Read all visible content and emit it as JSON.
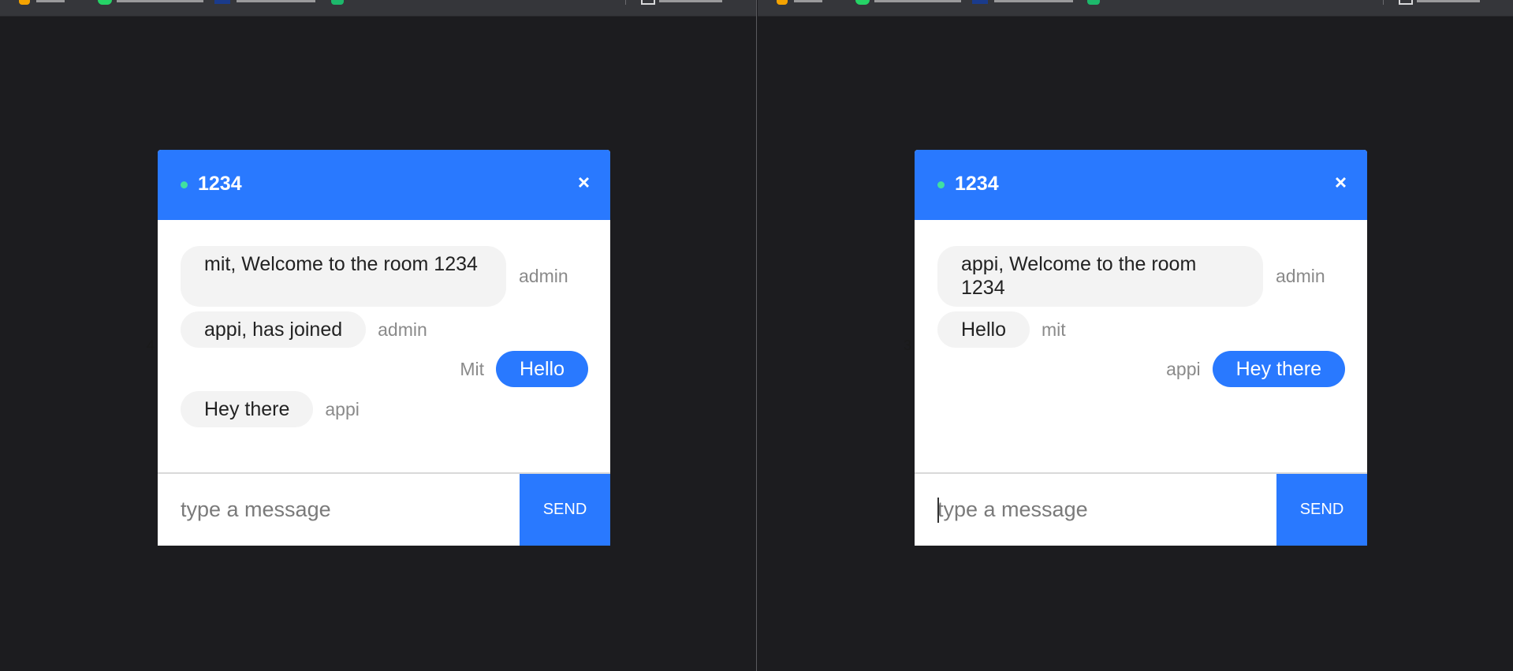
{
  "windows": [
    {
      "id": "left",
      "edge_glyph": "4",
      "room": "1234",
      "status_color": "#41e0a0",
      "close_icon": "×",
      "messages": [
        {
          "text": "mit, Welcome to the room 1234",
          "sender": "admin",
          "direction": "incoming"
        },
        {
          "text": "appi, has joined",
          "sender": "admin",
          "direction": "incoming"
        },
        {
          "text": "Hello",
          "sender": "Mit",
          "direction": "outgoing"
        },
        {
          "text": "Hey there",
          "sender": "appi",
          "direction": "incoming"
        }
      ],
      "input": {
        "placeholder": "type a message",
        "value": ""
      },
      "send_label": "SEND"
    },
    {
      "id": "right",
      "edge_glyph": "3",
      "room": "1234",
      "status_color": "#41e0a0",
      "close_icon": "×",
      "messages": [
        {
          "text": "appi, Welcome to the room 1234",
          "sender": "admin",
          "direction": "incoming"
        },
        {
          "text": "Hello",
          "sender": "mit",
          "direction": "incoming"
        },
        {
          "text": "Hey there",
          "sender": "appi",
          "direction": "outgoing"
        }
      ],
      "input": {
        "placeholder": "type a message",
        "value": ""
      },
      "send_label": "SEND"
    }
  ],
  "colors": {
    "accent": "#2979ff",
    "background": "#1c1c1f",
    "incoming_bubble": "#f3f3f3",
    "status_online": "#41e0a0"
  }
}
